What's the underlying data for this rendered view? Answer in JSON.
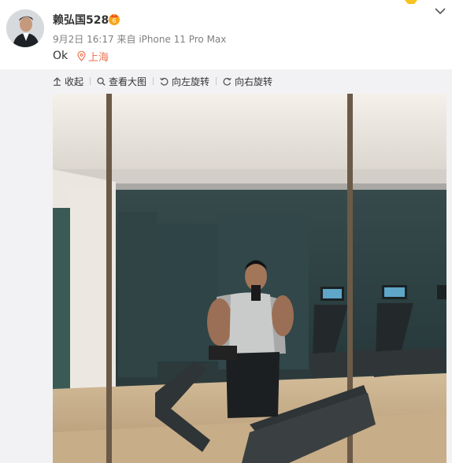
{
  "post": {
    "user_name": "赖弘国528",
    "meta_time": "9月2日 16:17",
    "meta_source": "来自 iPhone 11 Pro Max",
    "content": "Ok",
    "location": "上海"
  },
  "toolbar": {
    "collapse": "收起",
    "view_large": "查看大图",
    "rotate_left": "向左旋转",
    "rotate_right": "向右旋转"
  },
  "icons": [
    "avatar-photo",
    "vip-badge-icon",
    "chevron-down-icon",
    "location-pin-icon",
    "collapse-icon",
    "magnify-icon",
    "rotate-left-icon",
    "rotate-right-icon"
  ],
  "colors": {
    "accent": "#eb7350",
    "meta": "#808080",
    "text": "#333333",
    "panel": "#f2f2f5"
  }
}
